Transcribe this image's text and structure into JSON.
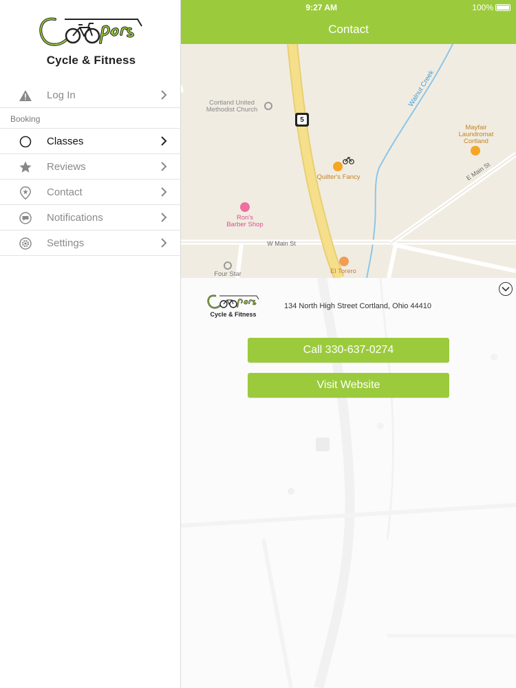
{
  "colors": {
    "accent": "#9bcb3c",
    "map_bg": "#f1ece2",
    "road_major": "#f6df8a",
    "water": "#8cc6e6"
  },
  "sidebar": {
    "logo_script": "Coopers",
    "logo_subtitle": "Cycle & Fitness",
    "items": [
      {
        "label": "Log In",
        "icon": "warning-icon"
      },
      {
        "label": "Classes",
        "icon": "circle-icon",
        "active": true
      },
      {
        "label": "Reviews",
        "icon": "star-icon"
      },
      {
        "label": "Contact",
        "icon": "location-pin-icon"
      },
      {
        "label": "Notifications",
        "icon": "chat-bubble-icon"
      },
      {
        "label": "Settings",
        "icon": "gear-icon"
      }
    ],
    "section_booking": "Booking"
  },
  "status": {
    "time": "9:27 AM",
    "battery": "100%"
  },
  "header": {
    "title": "Contact"
  },
  "map": {
    "labels": {
      "cortland_united": "Cortland United\nMethodist Church",
      "route": "5",
      "walnut_creek": "Walnut Creek",
      "mayfair": "Mayfair\nLaundromat\nCortland",
      "quilters": "Quilter's Fancy",
      "e_main": "E Main St",
      "rons": "Ron's\nBarber Shop",
      "w_main": "W Main St",
      "four_star": "Four Star",
      "el_torero": "El Torero"
    }
  },
  "info": {
    "logo_script": "Coopers",
    "logo_subtitle": "Cycle & Fitness",
    "address": "134 North High Street Cortland, Ohio 44410",
    "call_label": "Call 330-637-0274",
    "website_label": "Visit Website"
  }
}
